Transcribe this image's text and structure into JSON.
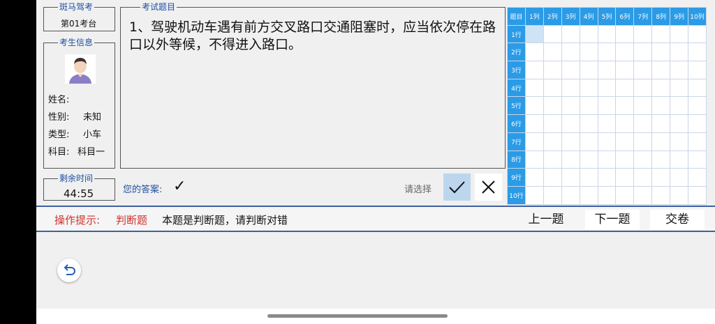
{
  "exam": {
    "title": "斑马驾考",
    "seat": "第01考台"
  },
  "student": {
    "legend": "考生信息",
    "name_label": "姓名:",
    "gender_label": "性别:",
    "gender_value": "未知",
    "type_label": "类型:",
    "type_value": "小车",
    "subject_label": "科目:",
    "subject_value": "科目一"
  },
  "timer": {
    "legend": "剩余时间",
    "value": "44:55"
  },
  "question": {
    "legend": "考试题目",
    "text": "1、驾驶机动车遇有前方交叉路口交通阻塞时，应当依次停在路口以外等候，不得进入路口。"
  },
  "answer": {
    "label": "您的答案:",
    "mark": "✓",
    "prompt": "请选择",
    "correct_icon": "check-icon",
    "wrong_icon": "x-icon"
  },
  "grid": {
    "corner": "题目",
    "cols": [
      "1列",
      "2列",
      "3列",
      "4列",
      "5列",
      "6列",
      "7列",
      "8列",
      "9列",
      "10列"
    ],
    "rows": [
      "1行",
      "2行",
      "3行",
      "4行",
      "5行",
      "6行",
      "7行",
      "8行",
      "9行",
      "10行"
    ],
    "selected": "1行1列"
  },
  "tips": {
    "label": "操作提示:",
    "type": "判断题",
    "text": "本题是判断题，请判断对错"
  },
  "nav": {
    "prev": "上一题",
    "next": "下一题",
    "submit": "交卷"
  },
  "colors": {
    "accent": "#2b9be6",
    "tip_red": "#d0312d",
    "legend_blue": "#1f4fa0"
  }
}
